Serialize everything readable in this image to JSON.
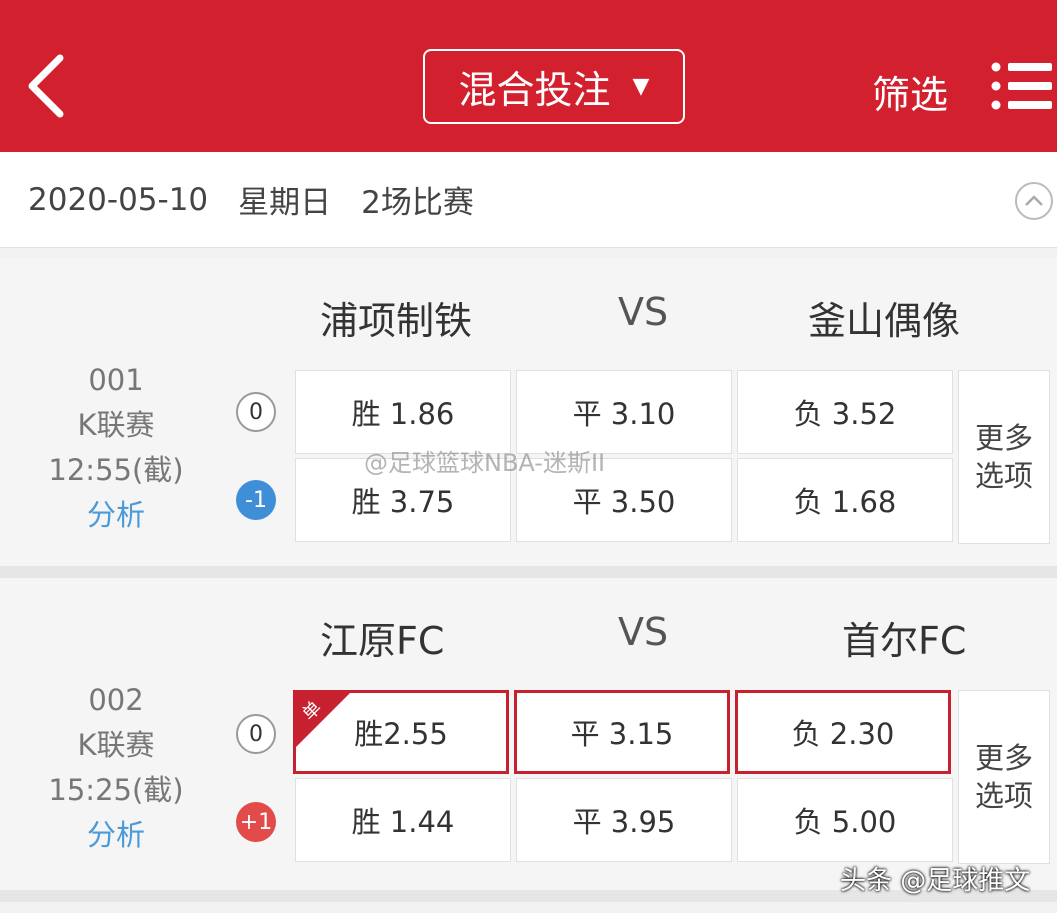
{
  "header": {
    "title": "混合投注",
    "title_caret": "▼",
    "filter_label": "筛选"
  },
  "date_bar": {
    "date": "2020-05-10",
    "weekday": "星期日",
    "count": "2场比赛"
  },
  "matches": [
    {
      "number": "001",
      "league": "K联赛",
      "time": "12:55(截)",
      "analysis": "分析",
      "home": "浦项制铁",
      "vs": "VS",
      "away": "釜山偶像",
      "handicap_main": "0",
      "handicap_alt": "-1",
      "row1": [
        "胜 1.86",
        "平 3.10",
        "负 3.52"
      ],
      "row2": [
        "胜 3.75",
        "平 3.50",
        "负 1.68"
      ],
      "more": [
        "更多",
        "选项"
      ]
    },
    {
      "number": "002",
      "league": "K联赛",
      "time": "15:25(截)",
      "analysis": "分析",
      "home": "江原FC",
      "vs": "VS",
      "away": "首尔FC",
      "handicap_main": "0",
      "handicap_alt": "+1",
      "single_badge": "单",
      "row1": [
        "胜2.55",
        "平 3.15",
        "负 2.30"
      ],
      "row2": [
        "胜 1.44",
        "平 3.95",
        "负 5.00"
      ],
      "more": [
        "更多",
        "选项"
      ]
    }
  ],
  "watermarks": {
    "center": "@足球篮球NBA-迷斯II",
    "corner": "头条 @足球推文"
  },
  "colors": {
    "header_bg": "#d3202f",
    "link": "#4b9ad9",
    "selected_border": "#c7202f"
  }
}
